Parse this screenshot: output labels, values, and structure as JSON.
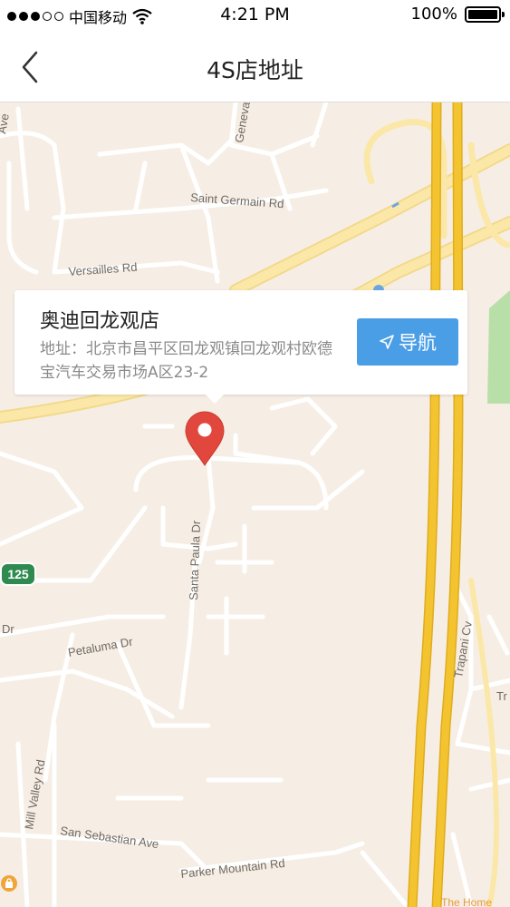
{
  "status_bar": {
    "carrier": "中国移动",
    "time": "4:21 PM",
    "battery": "100%"
  },
  "nav": {
    "title": "4S店地址"
  },
  "map": {
    "road_labels": {
      "ave_top_left": "Ave",
      "geneva": "Geneva",
      "saint_germain": "Saint Germain Rd",
      "versailles": "Versailles Rd",
      "santa_paula": "Santa Paula Dr",
      "petaluma": "Petaluma Dr",
      "dr_left": "Dr",
      "mill_valley": "Mill Valley Rd",
      "san_sebastian": "San Sebastian Ave",
      "parker_mountain": "Parker Mountain Rd",
      "trapani": "Trapani Cv",
      "tr_right": "Tr"
    },
    "route_shield": "125",
    "poi_label": "The Home"
  },
  "info_card": {
    "name": "奥迪回龙观店",
    "address": "地址：北京市昌平区回龙观镇回龙观村欧德宝汽车交易市场A区23-2",
    "navigate_label": "导航"
  },
  "colors": {
    "map_bg": "#f6eee5",
    "highway": "#f4c430",
    "primary_road": "#fbe8a8",
    "street": "#ffffff",
    "park": "#b9dfa9",
    "navigate_button": "#4a9ee6",
    "pin": "#e2473d"
  }
}
